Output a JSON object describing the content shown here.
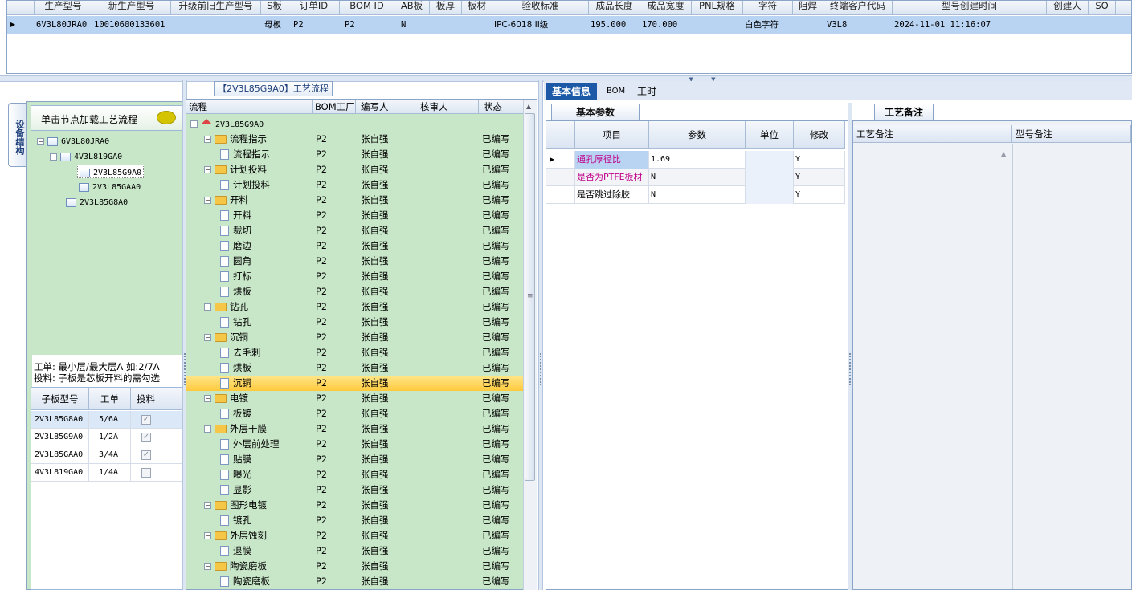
{
  "top_grid": {
    "headers": [
      "生产型号",
      "新生产型号",
      "升级前旧生产型号",
      "S板",
      "订单ID",
      "BOM ID",
      "AB板",
      "板厚",
      "板材",
      "验收标准",
      "成品长度",
      "成品宽度",
      "PNL规格",
      "字符",
      "阻焊",
      "终端客户代码",
      "型号创建时间",
      "创建人",
      "SO"
    ],
    "row": {
      "model": "6V3L80JRA0",
      "new_model": "10010600133601",
      "old_model": "",
      "s_board": "母板",
      "order_id": "P2",
      "bom_id": "P2",
      "ab": "N",
      "thickness": "",
      "material": "",
      "standard": "IPC-6018 II级",
      "length": "195.000",
      "width": "170.000",
      "pnl": "",
      "char": "白色字符",
      "mask": "",
      "customer": "V3L8",
      "created": "2024-11-01 11:16:07",
      "creator": "",
      "so": ""
    }
  },
  "left": {
    "vertical_tab": "设备结构",
    "hint": "单击节点加载工艺流程",
    "tree": [
      "6V3L80JRA0",
      "4V3L819GA0",
      "2V3L85G9A0",
      "2V3L85GAA0",
      "2V3L85G8A0"
    ],
    "note_line1": "工单: 最小层/最大层A 如:2/7A",
    "note_line2": "投料: 子板是芯板开料的需勾选",
    "grid_headers": [
      "子板型号",
      "工单",
      "投料"
    ],
    "grid_rows": [
      {
        "model": "2V3L85G8A0",
        "order": "5/6A",
        "checked": true
      },
      {
        "model": "2V3L85G9A0",
        "order": "1/2A",
        "checked": true
      },
      {
        "model": "2V3L85GAA0",
        "order": "3/4A",
        "checked": true
      },
      {
        "model": "4V3L819GA0",
        "order": "1/4A",
        "checked": false
      }
    ]
  },
  "flow": {
    "title": "【2V3L85G9A0】工艺流程",
    "headers": [
      "流程",
      "BOM工厂",
      "编写人",
      "核审人",
      "状态"
    ],
    "root": "2V3L85G9A0",
    "rows": [
      {
        "level": 1,
        "name": "流程指示",
        "factory": "P2",
        "writer": "张自强",
        "status": "已编写"
      },
      {
        "level": 2,
        "name": "流程指示",
        "factory": "P2",
        "writer": "张自强",
        "status": "已编写"
      },
      {
        "level": 1,
        "name": "计划投料",
        "factory": "P2",
        "writer": "张自强",
        "status": "已编写"
      },
      {
        "level": 2,
        "name": "计划投料",
        "factory": "P2",
        "writer": "张自强",
        "status": "已编写"
      },
      {
        "level": 1,
        "name": "开料",
        "factory": "P2",
        "writer": "张自强",
        "status": "已编写"
      },
      {
        "level": 2,
        "name": "开料",
        "factory": "P2",
        "writer": "张自强",
        "status": "已编写"
      },
      {
        "level": 2,
        "name": "裁切",
        "factory": "P2",
        "writer": "张自强",
        "status": "已编写"
      },
      {
        "level": 2,
        "name": "磨边",
        "factory": "P2",
        "writer": "张自强",
        "status": "已编写"
      },
      {
        "level": 2,
        "name": "圆角",
        "factory": "P2",
        "writer": "张自强",
        "status": "已编写"
      },
      {
        "level": 2,
        "name": "打标",
        "factory": "P2",
        "writer": "张自强",
        "status": "已编写"
      },
      {
        "level": 2,
        "name": "烘板",
        "factory": "P2",
        "writer": "张自强",
        "status": "已编写"
      },
      {
        "level": 1,
        "name": "钻孔",
        "factory": "P2",
        "writer": "张自强",
        "status": "已编写"
      },
      {
        "level": 2,
        "name": "钻孔",
        "factory": "P2",
        "writer": "张自强",
        "status": "已编写"
      },
      {
        "level": 1,
        "name": "沉铜",
        "factory": "P2",
        "writer": "张自强",
        "status": "已编写"
      },
      {
        "level": 2,
        "name": "去毛刺",
        "factory": "P2",
        "writer": "张自强",
        "status": "已编写"
      },
      {
        "level": 2,
        "name": "烘板",
        "factory": "P2",
        "writer": "张自强",
        "status": "已编写"
      },
      {
        "level": 2,
        "name": "沉铜",
        "factory": "P2",
        "writer": "张自强",
        "status": "已编写",
        "selected": true
      },
      {
        "level": 1,
        "name": "电镀",
        "factory": "P2",
        "writer": "张自强",
        "status": "已编写"
      },
      {
        "level": 2,
        "name": "板镀",
        "factory": "P2",
        "writer": "张自强",
        "status": "已编写"
      },
      {
        "level": 1,
        "name": "外层干膜",
        "factory": "P2",
        "writer": "张自强",
        "status": "已编写"
      },
      {
        "level": 2,
        "name": "外层前处理",
        "factory": "P2",
        "writer": "张自强",
        "status": "已编写"
      },
      {
        "level": 2,
        "name": "贴膜",
        "factory": "P2",
        "writer": "张自强",
        "status": "已编写"
      },
      {
        "level": 2,
        "name": "曝光",
        "factory": "P2",
        "writer": "张自强",
        "status": "已编写"
      },
      {
        "level": 2,
        "name": "显影",
        "factory": "P2",
        "writer": "张自强",
        "status": "已编写"
      },
      {
        "level": 1,
        "name": "图形电镀",
        "factory": "P2",
        "writer": "张自强",
        "status": "已编写"
      },
      {
        "level": 2,
        "name": "镀孔",
        "factory": "P2",
        "writer": "张自强",
        "status": "已编写"
      },
      {
        "level": 1,
        "name": "外层蚀刻",
        "factory": "P2",
        "writer": "张自强",
        "status": "已编写"
      },
      {
        "level": 2,
        "name": "退膜",
        "factory": "P2",
        "writer": "张自强",
        "status": "已编写"
      },
      {
        "level": 1,
        "name": "陶瓷磨板",
        "factory": "P2",
        "writer": "张自强",
        "status": "已编写"
      },
      {
        "level": 2,
        "name": "陶瓷磨板",
        "factory": "P2",
        "writer": "张自强",
        "status": "已编写"
      }
    ]
  },
  "tabs": [
    "基本信息",
    "BOM",
    "工时"
  ],
  "params": {
    "title": "基本参数",
    "headers": [
      "项目",
      "参数",
      "单位",
      "修改"
    ],
    "rows": [
      {
        "item": "通孔厚径比",
        "value": "1.69",
        "unit": "",
        "edit": "Y"
      },
      {
        "item": "是否为PTFE板材",
        "value": "N",
        "unit": "",
        "edit": "Y"
      },
      {
        "item": "是否跳过除胶",
        "value": "N",
        "unit": "",
        "edit": "Y"
      }
    ]
  },
  "notes": {
    "title": "工艺备注",
    "headers": [
      "工艺备注",
      "型号备注"
    ]
  },
  "colors": {
    "selected_row": "#b9d3f3",
    "tree_bg": "#c8e6c8",
    "highlight": "#ffd35a",
    "accent_text": "#c0008a",
    "tab_active": "#1c5aa8"
  }
}
